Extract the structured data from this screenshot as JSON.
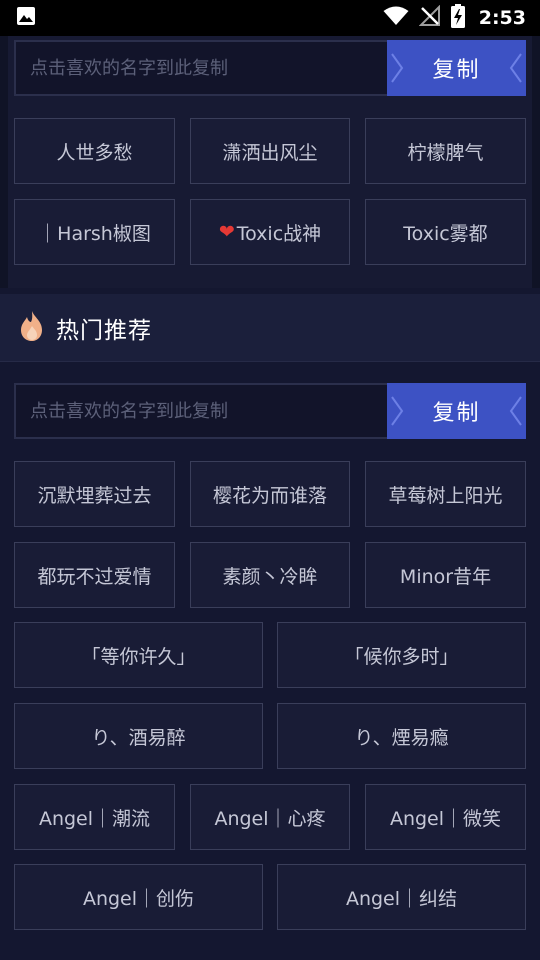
{
  "status_bar": {
    "time": "2:53",
    "icons": [
      "image-icon",
      "wifi-icon",
      "no-signal-icon",
      "battery-charging-icon"
    ]
  },
  "top_section": {
    "input_placeholder": "点击喜欢的名字到此复制",
    "copy_label": "复制",
    "tags": [
      "人世多愁",
      "潇洒出风尘",
      "柠檬脾气",
      "｜Harsh椒图",
      "Toxic战神",
      "Toxic雾都"
    ]
  },
  "hot_section": {
    "title": "热门推荐",
    "title_icon": "flame-icon",
    "input_placeholder": "点击喜欢的名字到此复制",
    "copy_label": "复制",
    "tags": [
      "沉默埋葬过去",
      "樱花为而谁落",
      "草莓树上阳光",
      "都玩不过爱情",
      "素颜丶冷眸",
      "Minor昔年",
      "「等你许久」",
      "「候你多时」",
      "り、酒易醉",
      "り、煙易瘾",
      "Angel｜潮流",
      "Angel｜心疼",
      "Angel｜微笑",
      "Angel｜创伤",
      "Angel｜纠结"
    ]
  },
  "colors": {
    "background": "#141730",
    "accent": "#3d52c4",
    "heart": "#e53935",
    "flame": "#f0b089"
  }
}
